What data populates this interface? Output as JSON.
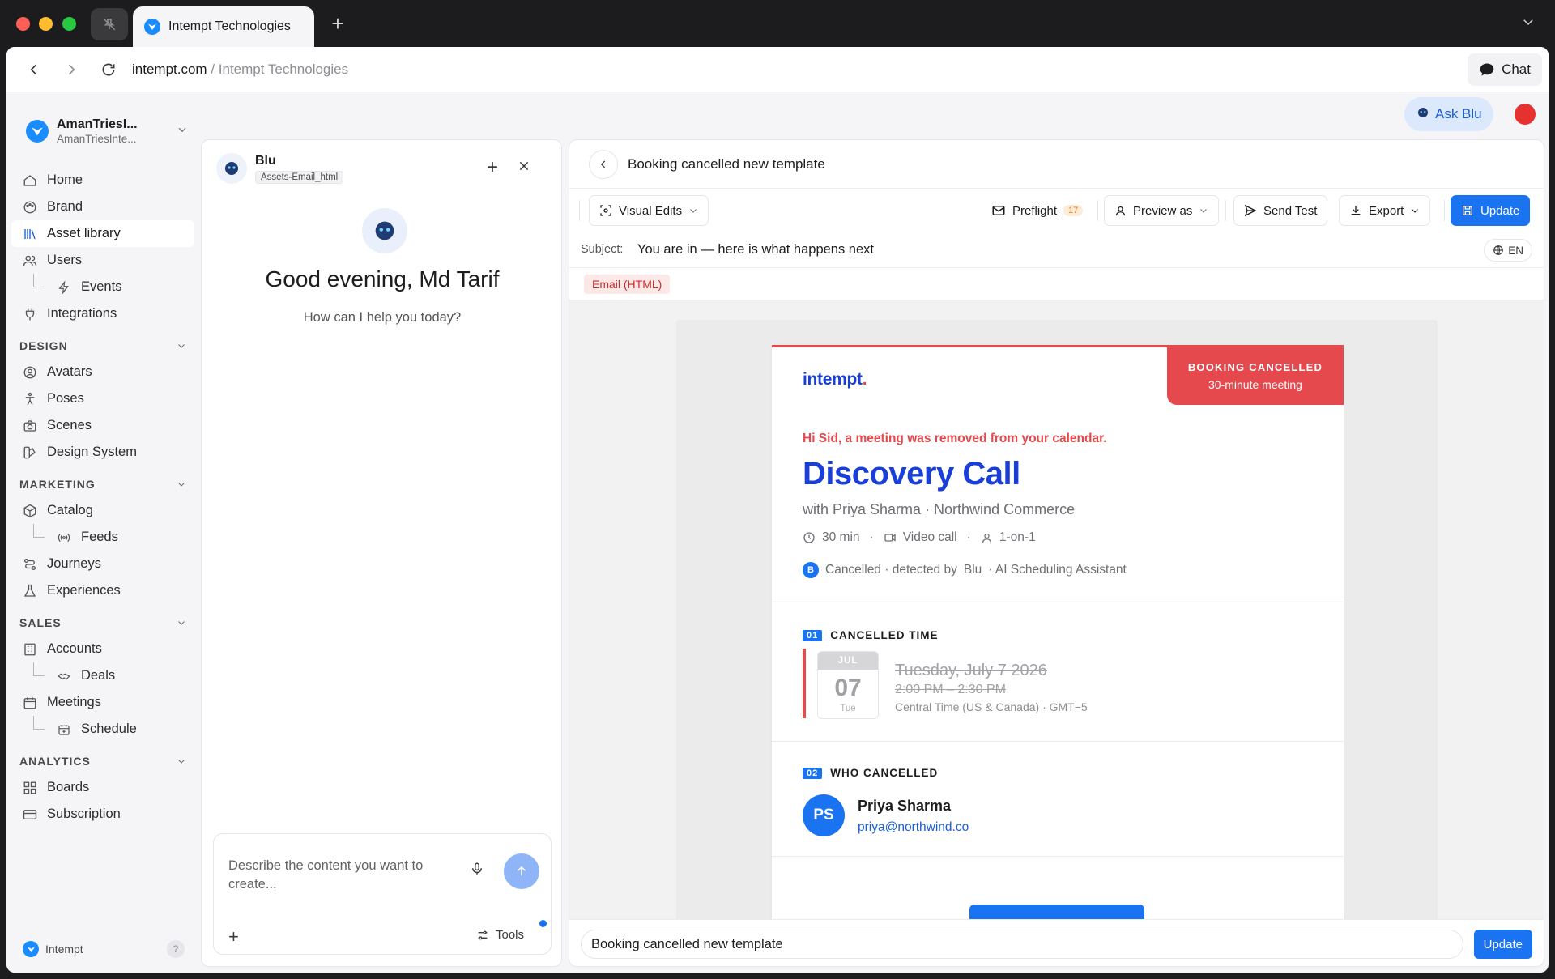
{
  "browser": {
    "tab_title": "Intempt Technologies",
    "url_domain": "intempt.com",
    "url_path": " / Intempt Technologies",
    "chat_label": "Chat"
  },
  "workspace": {
    "name": "AmanTriesI...",
    "sub": "AmanTriesInte..."
  },
  "nav": {
    "items": [
      {
        "label": "Home",
        "icon": "home-icon"
      },
      {
        "label": "Brand",
        "icon": "palette-icon"
      },
      {
        "label": "Asset library",
        "icon": "library-icon"
      },
      {
        "label": "Users",
        "icon": "users-icon"
      },
      {
        "label": "Events",
        "icon": "bolt-icon"
      },
      {
        "label": "Integrations",
        "icon": "plug-icon"
      },
      {
        "label": "Avatars",
        "icon": "avatar-icon"
      },
      {
        "label": "Poses",
        "icon": "pose-icon"
      },
      {
        "label": "Scenes",
        "icon": "camera-icon"
      },
      {
        "label": "Design System",
        "icon": "design-icon"
      },
      {
        "label": "Catalog",
        "icon": "box-icon"
      },
      {
        "label": "Feeds",
        "icon": "broadcast-icon"
      },
      {
        "label": "Journeys",
        "icon": "route-icon"
      },
      {
        "label": "Experiences",
        "icon": "flask-icon"
      },
      {
        "label": "Accounts",
        "icon": "building-icon"
      },
      {
        "label": "Deals",
        "icon": "handshake-icon"
      },
      {
        "label": "Meetings",
        "icon": "calendar-icon"
      },
      {
        "label": "Schedule",
        "icon": "schedule-icon"
      },
      {
        "label": "Boards",
        "icon": "grid-icon"
      },
      {
        "label": "Subscription",
        "icon": "card-icon"
      }
    ],
    "sections": {
      "design": "DESIGN",
      "marketing": "MARKETING",
      "sales": "SALES",
      "analytics": "ANALYTICS"
    },
    "footer_label": "Intempt",
    "help": "?"
  },
  "top": {
    "ask_blu": "Ask Blu"
  },
  "chat_panel": {
    "name": "Blu",
    "tag": "Assets-Email_html",
    "greeting": "Good evening, Md Tarif",
    "help_text": "How can I help you today?",
    "input_placeholder": "Describe the content you want to create...",
    "tools_label": "Tools"
  },
  "editor": {
    "title": "Booking cancelled new template",
    "toolbar": {
      "visual_edits": "Visual Edits",
      "preflight": "Preflight",
      "preflight_count": "17",
      "preview_as": "Preview as",
      "send_test": "Send Test",
      "export": "Export",
      "update": "Update"
    },
    "subject_label": "Subject:",
    "subject_value": "You are in — here is what happens next",
    "language": "EN",
    "format_badge": "Email (HTML)",
    "bottom_input_value": "Booking cancelled new template",
    "bottom_update": "Update"
  },
  "email": {
    "logo": "intempt",
    "logo_dot": ".",
    "tag_title": "BOOKING CANCELLED",
    "tag_sub": "30-minute meeting",
    "hi_line": "Hi Sid, a meeting was removed from your calendar.",
    "title": "Discovery Call",
    "with_line": "with Priya Sharma · Northwind Commerce",
    "meta": {
      "duration": "30 min",
      "sep": "·",
      "channel": "Video call",
      "type": "1-on-1"
    },
    "status": {
      "badge": "B",
      "text1": "Cancelled · detected by",
      "agent": "Blu",
      "text2": "· AI Scheduling Assistant"
    },
    "section1": {
      "num": "01",
      "title": "CANCELLED TIME"
    },
    "calendar": {
      "month": "JUL",
      "day": "07",
      "weekday": "Tue"
    },
    "cancelled_date": "Tuesday, July 7 2026",
    "cancelled_time": "2:00 PM – 2:30 PM",
    "timezone": "Central Time (US & Canada) · GMT−5",
    "section2": {
      "num": "02",
      "title": "WHO CANCELLED"
    },
    "person": {
      "initials": "PS",
      "name": "Priya Sharma",
      "email": "priya@northwind.co"
    }
  },
  "colors": {
    "accent": "#1a73f0",
    "brand_blue": "#1a3fd8",
    "cancel_red": "#e5484d"
  }
}
